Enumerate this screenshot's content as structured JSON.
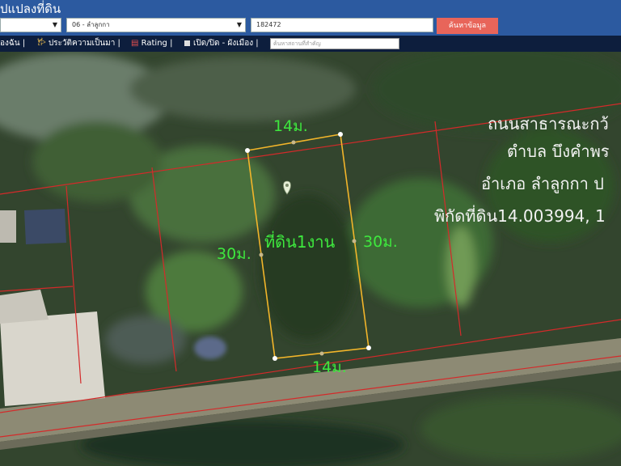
{
  "header": {
    "title": "ปแปลงที่ดิน",
    "district_select": "06 - ลำลูกกา",
    "parcel_input": "182472",
    "search_button": "ค้นหาข้อมูล"
  },
  "toolbar": {
    "item1": "องฉัน",
    "item2": "ประวัติความเป็นมา",
    "item3": "Rating",
    "item4": "เปิด/ปิด - ผังเมือง",
    "search_placeholder": "ค้นหาสถานที่สำคัญ"
  },
  "map": {
    "dim_top": "14ม.",
    "dim_bottom": "14ม.",
    "dim_left": "30ม.",
    "dim_right": "30ม.",
    "plot_label": "ที่ดิน1งาน",
    "info_line1": "ถนนสาธารณะกว้",
    "info_line2": "ตำบล บึงคำพร",
    "info_line3": "อำเภอ ลำลูกกา ป",
    "info_line4": "พิกัดที่ดิน14.003994, 1",
    "colors": {
      "parcel_line": "#d42a2a",
      "plot_outline": "#f2b52a",
      "dim_text": "#3ee83e"
    }
  }
}
